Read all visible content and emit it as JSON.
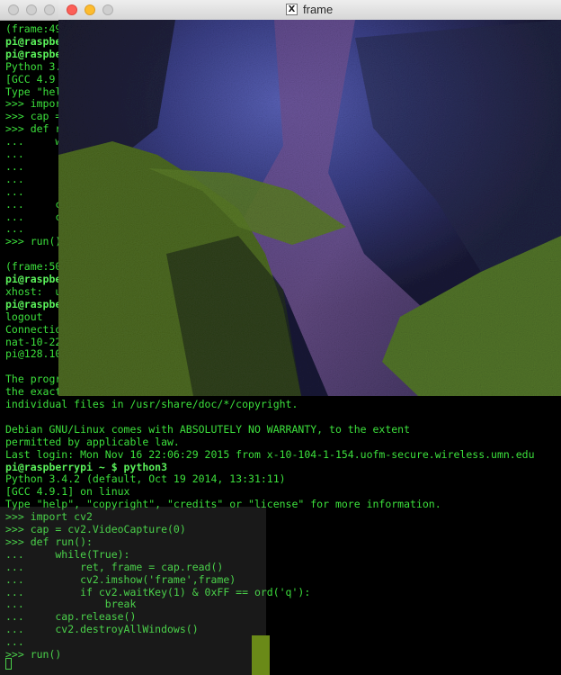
{
  "frame_window": {
    "title": "frame",
    "x_icon_glyph": "X"
  },
  "terminal": {
    "lines": [
      {
        "text": "(frame:49",
        "bold": false
      },
      {
        "text": "pi@raspbe",
        "bold": true
      },
      {
        "text": "pi@raspbe",
        "bold": true
      },
      {
        "text": "Python 3.4",
        "bold": false
      },
      {
        "text": "[GCC 4.9",
        "bold": false
      },
      {
        "text": "Type \"help",
        "bold": false
      },
      {
        "text": ">>> impor",
        "bold": false
      },
      {
        "text": ">>> cap =",
        "bold": false
      },
      {
        "text": ">>> def r",
        "bold": false
      },
      {
        "text": "...     w",
        "bold": false
      },
      {
        "text": "...",
        "bold": false
      },
      {
        "text": "...",
        "bold": false
      },
      {
        "text": "...",
        "bold": false
      },
      {
        "text": "...",
        "bold": false
      },
      {
        "text": "...     c",
        "bold": false
      },
      {
        "text": "...     c",
        "bold": false
      },
      {
        "text": "...",
        "bold": false
      },
      {
        "text": ">>> run()",
        "bold": false
      },
      {
        "text": "",
        "bold": false
      },
      {
        "text": "(frame:50",
        "bold": false
      },
      {
        "text": "pi@raspbe",
        "bold": true
      },
      {
        "text": "xhost:  u",
        "bold": false
      },
      {
        "text": "pi@raspbe",
        "bold": true
      },
      {
        "text": "logout",
        "bold": false
      },
      {
        "text": "Connectio",
        "bold": false
      },
      {
        "text": "nat-10-22",
        "bold": false
      },
      {
        "text": "pi@128.10",
        "bold": false
      },
      {
        "text": "",
        "bold": false
      },
      {
        "text": "The progr",
        "bold": false
      },
      {
        "text": "the exact",
        "bold": false
      },
      {
        "text": "individual files in /usr/share/doc/*/copyright.",
        "bold": false
      },
      {
        "text": "",
        "bold": false
      },
      {
        "text": "Debian GNU/Linux comes with ABSOLUTELY NO WARRANTY, to the extent",
        "bold": false
      },
      {
        "text": "permitted by applicable law.",
        "bold": false
      },
      {
        "text": "Last login: Mon Nov 16 22:06:29 2015 from x-10-104-1-154.uofm-secure.wireless.umn.edu",
        "bold": false
      },
      {
        "text": "pi@raspberrypi ~ $ python3",
        "bold": true
      },
      {
        "text": "Python 3.4.2 (default, Oct 19 2014, 13:31:11)",
        "bold": false
      },
      {
        "text": "[GCC 4.9.1] on linux",
        "bold": false
      },
      {
        "text": "Type \"help\", \"copyright\", \"credits\" or \"license\" for more information.",
        "bold": false
      },
      {
        "text": ">>> import cv2",
        "bold": false
      },
      {
        "text": ">>> cap = cv2.VideoCapture(0)",
        "bold": false
      },
      {
        "text": ">>> def run():",
        "bold": false
      },
      {
        "text": "...     while(True):",
        "bold": false
      },
      {
        "text": "...         ret, frame = cap.read()",
        "bold": false
      },
      {
        "text": "...         cv2.imshow('frame',frame)",
        "bold": false
      },
      {
        "text": "...         if cv2.waitKey(1) & 0xFF == ord('q'):",
        "bold": false
      },
      {
        "text": "...             break",
        "bold": false
      },
      {
        "text": "...     cap.release()",
        "bold": false
      },
      {
        "text": "...     cv2.destroyAllWindows()",
        "bold": false
      },
      {
        "text": "...",
        "bold": false
      },
      {
        "text": ">>> run()",
        "bold": false
      }
    ]
  },
  "colors": {
    "terminal_text": "#3ce03c",
    "terminal_bg": "#000000",
    "close": "#fc5f57",
    "minimize": "#fdbc2e"
  }
}
